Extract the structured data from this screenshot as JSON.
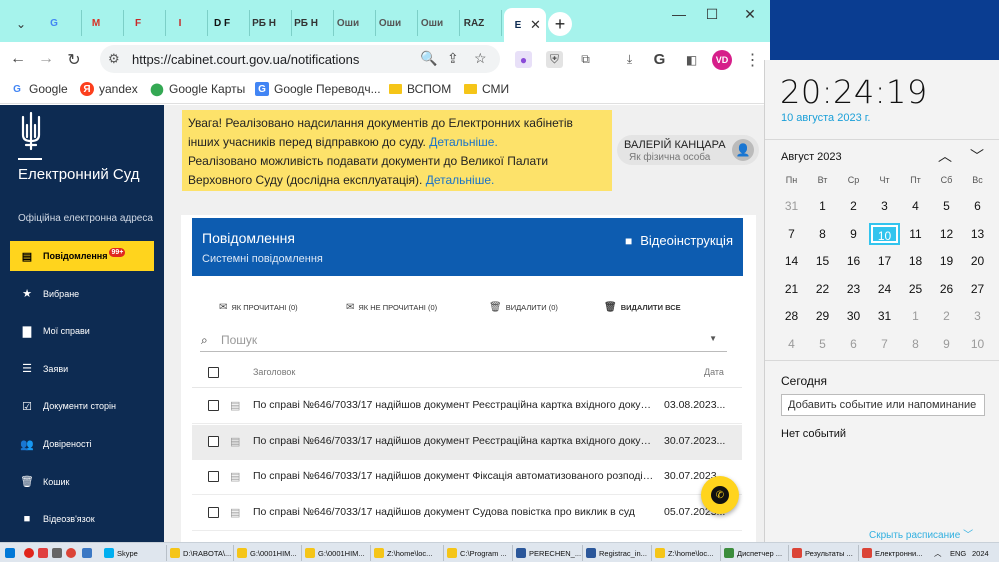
{
  "browser": {
    "tabs": [
      {
        "label": "G",
        "favicon": "google-icon",
        "color": "#4285f4"
      },
      {
        "label": "M",
        "favicon": "gmail-icon",
        "color": "#d93025"
      },
      {
        "label": "F",
        "favicon": "site-icon",
        "color": "#c62828"
      },
      {
        "label": "I",
        "favicon": "site-icon",
        "color": "#c62828"
      },
      {
        "label": "D F",
        "favicon": "site-icon",
        "color": "#111111"
      },
      {
        "label": "РБ Н",
        "favicon": "site-icon",
        "color": "#333333"
      },
      {
        "label": "РБ Н",
        "favicon": "site-icon",
        "color": "#333333"
      },
      {
        "label": "Оши",
        "favicon": "site-icon",
        "color": "#555555"
      },
      {
        "label": "Оши",
        "favicon": "site-icon",
        "color": "#555555"
      },
      {
        "label": "Оши",
        "favicon": "site-icon",
        "color": "#555555"
      },
      {
        "label": "RAZ",
        "favicon": "site-icon",
        "color": "#333333"
      },
      {
        "label": "Е",
        "favicon": "court-icon",
        "color": "#0d2b52",
        "active": true
      }
    ],
    "new_tab_label": "+",
    "url": "https://cabinet.court.gov.ua/notifications",
    "profile_initials": "VD",
    "bookmarks": [
      {
        "label": "Google",
        "icon": "google-icon"
      },
      {
        "label": "yandex",
        "icon": "yandex-icon"
      },
      {
        "label": "Google Карты",
        "icon": "maps-icon"
      },
      {
        "label": "Google Переводч...",
        "icon": "translate-icon"
      },
      {
        "label": "ВСПОМ",
        "icon": "folder-icon"
      },
      {
        "label": "СМИ",
        "icon": "folder-icon"
      }
    ]
  },
  "sidebar": {
    "title": "Електронний Суд",
    "subtitle": "Офіційна електронна адреса",
    "items": [
      {
        "label": "Повідомлення",
        "icon": "message-icon",
        "badge": "99+",
        "active": true
      },
      {
        "label": "Вибране",
        "icon": "star-icon"
      },
      {
        "label": "Мої справи",
        "icon": "folder-icon"
      },
      {
        "label": "Заяви",
        "icon": "list-icon"
      },
      {
        "label": "Документи сторін",
        "icon": "checklist-icon"
      },
      {
        "label": "Довіреності",
        "icon": "people-icon"
      },
      {
        "label": "Кошик",
        "icon": "trash-icon"
      },
      {
        "label": "Відеозв'язок",
        "icon": "video-icon"
      }
    ]
  },
  "notice": {
    "line1": "Увага! Реалізовано надсилання документів до Електронних кабінетів інших учасників перед відправкою до суду.",
    "link1": "Детальніше.",
    "line2": "Реалізовано можливість подавати документи до Великої Палати Верховного Суду (дослідна експлуатація).",
    "link2": "Детальніше."
  },
  "user": {
    "name": "ВАЛЕРІЙ КАНЦАРА",
    "role": "Як фізична особа"
  },
  "messages": {
    "title": "Повідомлення",
    "subtitle": "Системні повідомлення",
    "video_instruction": "Відеоінструкція",
    "actions": {
      "mark_read": "ЯК ПРОЧИТАНІ (0)",
      "mark_unread": "ЯК НЕ ПРОЧИТАНІ (0)",
      "delete": "ВИДАЛИТИ (0)",
      "delete_all": "ВИДАЛИТИ ВСЕ"
    },
    "search_placeholder": "Пошук",
    "columns": {
      "title": "Заголовок",
      "date": "Дата"
    },
    "rows": [
      {
        "text": "По справі №646/7033/17 надійшов документ Реєстраційна картка вхідного докуме...",
        "date": "03.08.2023..."
      },
      {
        "text": "По справі №646/7033/17 надійшов документ Реєстраційна картка вхідного докуме...",
        "date": "30.07.2023..."
      },
      {
        "text": "По справі №646/7033/17 надійшов документ Фіксація автоматизованого розподілу...",
        "date": "30.07.2023..."
      },
      {
        "text": "По справі №646/7033/17 надійшов документ Судова повістка про виклик в суд",
        "date": "05.07.2023..."
      }
    ]
  },
  "clock": {
    "time": "20:24:19",
    "date": "10 августа 2023 г.",
    "month": "Август 2023",
    "weekdays": [
      "Пн",
      "Вт",
      "Ср",
      "Чт",
      "Пт",
      "Сб",
      "Вс"
    ],
    "days": [
      [
        "31",
        "1",
        "2",
        "3",
        "4",
        "5",
        "6"
      ],
      [
        "7",
        "8",
        "9",
        "10",
        "11",
        "12",
        "13"
      ],
      [
        "14",
        "15",
        "16",
        "17",
        "18",
        "19",
        "20"
      ],
      [
        "21",
        "22",
        "23",
        "24",
        "25",
        "26",
        "27"
      ],
      [
        "28",
        "29",
        "30",
        "31",
        "1",
        "2",
        "3"
      ],
      [
        "4",
        "5",
        "6",
        "7",
        "8",
        "9",
        "10"
      ]
    ],
    "today": "10",
    "today_label": "Сегодня",
    "add_event": "Добавить событие или напоминание",
    "no_events": "Нет событий",
    "hide_schedule": "Скрыть расписание"
  },
  "taskbar": {
    "items": [
      {
        "label": "Skype",
        "icon": "skype-icon",
        "color": "#00aff0"
      },
      {
        "label": "D:\\RABOTA\\...",
        "icon": "folder-icon",
        "color": "#f5c518"
      },
      {
        "label": "G:\\0001НІМ...",
        "icon": "folder-icon",
        "color": "#f5c518"
      },
      {
        "label": "G:\\0001НІМ...",
        "icon": "folder-icon",
        "color": "#f5c518"
      },
      {
        "label": "Z:\\home\\loc...",
        "icon": "folder-icon",
        "color": "#f5c518"
      },
      {
        "label": "C:\\Program ...",
        "icon": "folder-icon",
        "color": "#f5c518"
      },
      {
        "label": "PERECHEN_...",
        "icon": "word-icon",
        "color": "#2b579a"
      },
      {
        "label": "Registrac_in...",
        "icon": "word-icon",
        "color": "#2b579a"
      },
      {
        "label": "Z:\\home\\loc...",
        "icon": "folder-icon",
        "color": "#f5c518"
      },
      {
        "label": "Диспетчер ...",
        "icon": "taskmgr-icon",
        "color": "#3c8d3c"
      },
      {
        "label": "Результаты ...",
        "icon": "chrome-icon",
        "color": "#db4437"
      },
      {
        "label": "Електронни...",
        "icon": "chrome-icon",
        "color": "#db4437"
      }
    ],
    "lang": "ENG",
    "year": "2024"
  }
}
